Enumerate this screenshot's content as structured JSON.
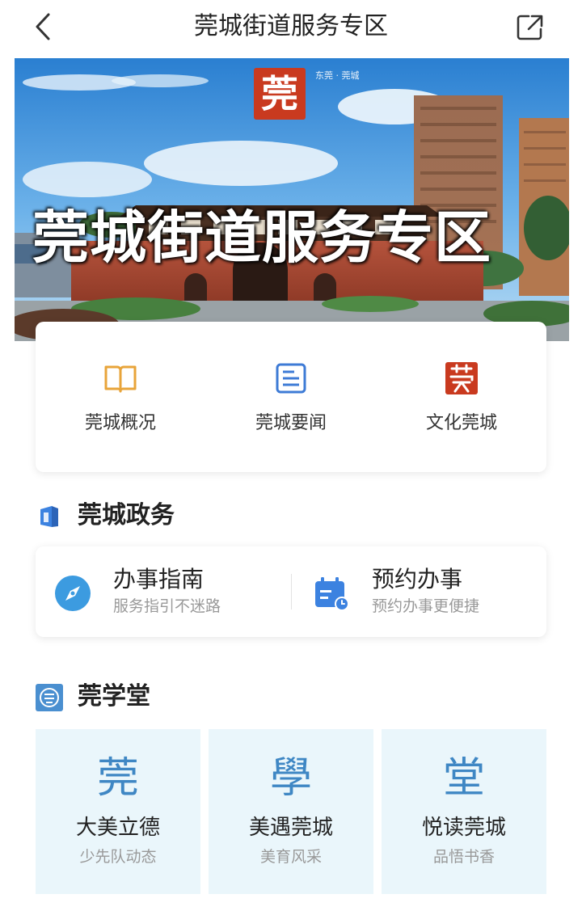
{
  "header": {
    "title": "莞城街道服务专区",
    "back_icon": "chevron-left-icon",
    "share_icon": "share-external-icon"
  },
  "banner": {
    "title": "莞城街道服务专区",
    "seal_char": "莞",
    "seal_caption": "东莞 · 莞城"
  },
  "quick_menu": [
    {
      "label": "莞城概况",
      "icon": "book-icon",
      "color": "#e8a43a"
    },
    {
      "label": "莞城要闻",
      "icon": "news-icon",
      "color": "#3e7bd6"
    },
    {
      "label": "文化莞城",
      "icon": "guan-seal-icon",
      "color": "#c93a1f"
    }
  ],
  "sections": {
    "gov": {
      "title": "莞城政务",
      "icon": "government-icon"
    },
    "learn": {
      "title": "莞学堂",
      "icon": "seal-badge-icon"
    }
  },
  "gov_services": [
    {
      "title": "办事指南",
      "subtitle": "服务指引不迷路",
      "icon": "compass-icon",
      "color": "#3c9be0"
    },
    {
      "title": "预约办事",
      "subtitle": "预约办事更便捷",
      "icon": "calendar-clock-icon",
      "color": "#3c82e0"
    }
  ],
  "learn_cards": [
    {
      "glyph": "莞",
      "title": "大美立德",
      "subtitle": "少先队动态"
    },
    {
      "glyph": "學",
      "title": "美遇莞城",
      "subtitle": "美育风采"
    },
    {
      "glyph": "堂",
      "title": "悦读莞城",
      "subtitle": "品悟书香"
    }
  ],
  "colors": {
    "accent_blue": "#3c82e0",
    "learn_bg": "#eaf6fb",
    "seal_red": "#c93a1f"
  }
}
